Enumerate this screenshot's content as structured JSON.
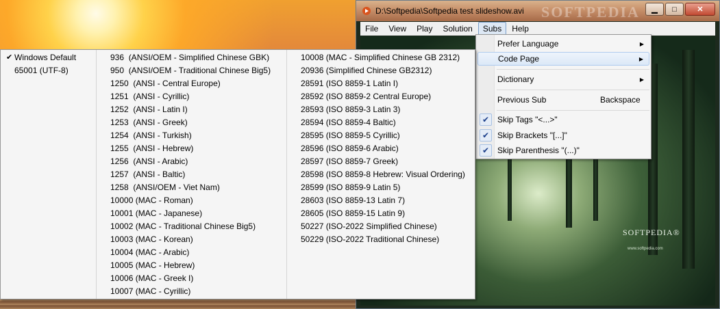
{
  "window": {
    "title": "D:\\Softpedia\\Softpedia test slideshow.avi",
    "watermark": "SOFTPEDIA",
    "minimize": "▁",
    "maximize": "□",
    "close": "✕"
  },
  "menubar": {
    "items": [
      "File",
      "View",
      "Play",
      "Solution",
      "Subs",
      "Help"
    ],
    "active": "Subs"
  },
  "video": {
    "logo": "SOFTPEDIA®",
    "logo_url": "www.softpedia.com"
  },
  "subs_menu": {
    "items": [
      {
        "label": "Prefer Language",
        "submenu": true
      },
      {
        "label": "Code Page",
        "submenu": true,
        "highlighted": true
      },
      {
        "label": "Dictionary",
        "submenu": true
      },
      {
        "label": "Previous Sub",
        "shortcut": "Backspace"
      },
      {
        "label": "Skip Tags \"<...>\"",
        "checked": true
      },
      {
        "label": "Skip Brackets \"[...]\"",
        "checked": true
      },
      {
        "label": "Skip Parenthesis \"(...)\"",
        "checked": true
      }
    ]
  },
  "code_page_menu": {
    "column1": [
      {
        "label": "Windows Default",
        "checked": true
      },
      {
        "label": "65001 (UTF-8)",
        "checked": false
      }
    ],
    "column2": [
      "936  (ANSI/OEM - Simplified Chinese GBK)",
      "950  (ANSI/OEM - Traditional Chinese Big5)",
      "1250  (ANSI - Central Europe)",
      "1251  (ANSI - Cyrillic)",
      "1252  (ANSI - Latin I)",
      "1253  (ANSI - Greek)",
      "1254  (ANSI - Turkish)",
      "1255  (ANSI - Hebrew)",
      "1256  (ANSI - Arabic)",
      "1257  (ANSI - Baltic)",
      "1258  (ANSI/OEM - Viet Nam)",
      "10000 (MAC - Roman)",
      "10001 (MAC - Japanese)",
      "10002 (MAC - Traditional Chinese Big5)",
      "10003 (MAC - Korean)",
      "10004 (MAC - Arabic)",
      "10005 (MAC - Hebrew)",
      "10006 (MAC - Greek I)",
      "10007 (MAC - Cyrillic)"
    ],
    "column3": [
      "10008 (MAC - Simplified Chinese GB 2312)",
      "20936 (Simplified Chinese GB2312)",
      "28591 (ISO 8859-1 Latin I)",
      "28592 (ISO 8859-2 Central Europe)",
      "28593 (ISO 8859-3 Latin 3)",
      "28594 (ISO 8859-4 Baltic)",
      "28595 (ISO 8859-5 Cyrillic)",
      "28596 (ISO 8859-6 Arabic)",
      "28597 (ISO 8859-7 Greek)",
      "28598 (ISO 8859-8 Hebrew: Visual Ordering)",
      "28599 (ISO 8859-9 Latin 5)",
      "28603 (ISO 8859-13 Latin 7)",
      "28605 (ISO 8859-15 Latin 9)",
      "50227 (ISO-2022 Simplified Chinese)",
      "50229 (ISO-2022 Traditional Chinese)"
    ]
  },
  "icons": {
    "check": "✔",
    "submenu_arrow": "▶"
  }
}
